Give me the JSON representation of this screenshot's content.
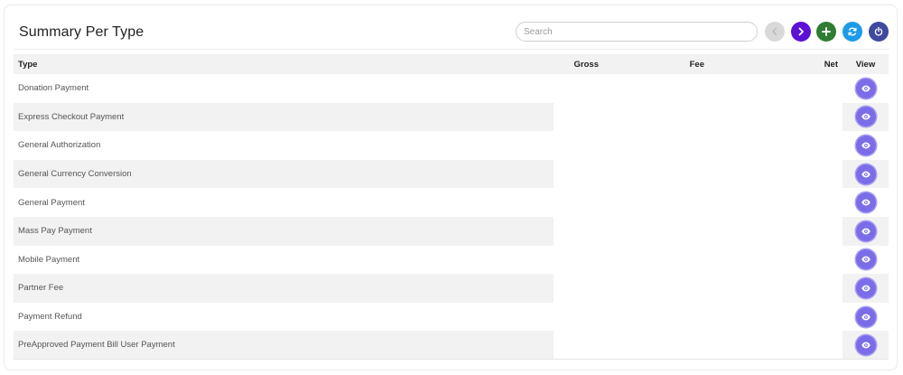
{
  "header": {
    "title": "Summary Per Type",
    "search_placeholder": "Search",
    "search_value": ""
  },
  "toolbar": {
    "buttons": [
      {
        "name": "prev-button",
        "icon": "chevron-left-icon",
        "color": "#d9d9d9",
        "enabled": false
      },
      {
        "name": "next-button",
        "icon": "chevron-right-icon",
        "color": "#5b11d6",
        "enabled": true
      },
      {
        "name": "add-button",
        "icon": "plus-icon",
        "color": "#2e7d32",
        "enabled": true
      },
      {
        "name": "refresh-button",
        "icon": "refresh-icon",
        "color": "#1e9be8",
        "enabled": true
      },
      {
        "name": "power-button",
        "icon": "power-icon",
        "color": "#3e4a9e",
        "enabled": true
      }
    ]
  },
  "table": {
    "columns": {
      "type": "Type",
      "gross": "Gross",
      "fee": "Fee",
      "net": "Net",
      "view": "View"
    },
    "rows": [
      {
        "type": "Donation Payment",
        "gross": "",
        "fee": "",
        "net": ""
      },
      {
        "type": "Express Checkout Payment",
        "gross": "",
        "fee": "",
        "net": ""
      },
      {
        "type": "General Authorization",
        "gross": "",
        "fee": "",
        "net": ""
      },
      {
        "type": "General Currency Conversion",
        "gross": "",
        "fee": "",
        "net": ""
      },
      {
        "type": "General Payment",
        "gross": "",
        "fee": "",
        "net": ""
      },
      {
        "type": "Mass Pay Payment",
        "gross": "",
        "fee": "",
        "net": ""
      },
      {
        "type": "Mobile Payment",
        "gross": "",
        "fee": "",
        "net": ""
      },
      {
        "type": "Partner Fee",
        "gross": "",
        "fee": "",
        "net": ""
      },
      {
        "type": "Payment Refund",
        "gross": "",
        "fee": "",
        "net": ""
      },
      {
        "type": "PreApproved Payment Bill User Payment",
        "gross": "",
        "fee": "",
        "net": ""
      }
    ]
  },
  "colors": {
    "view_button": "#7b6ce8",
    "stripe": "#f2f2f2"
  }
}
